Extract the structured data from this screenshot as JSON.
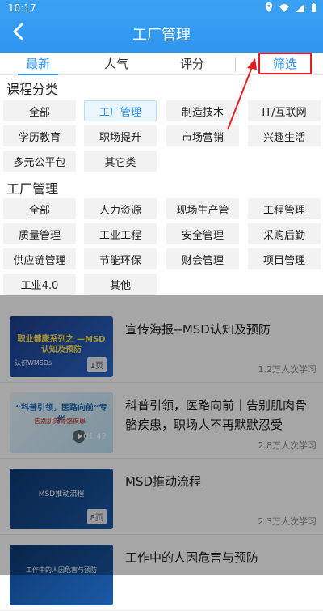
{
  "status": {
    "time": "10:17"
  },
  "header": {
    "title": "工厂管理"
  },
  "tabs": [
    {
      "label": "最新",
      "active": true
    },
    {
      "label": "人气",
      "active": false
    },
    {
      "label": "评分",
      "active": false
    },
    {
      "label": "筛选",
      "active": false
    }
  ],
  "sections": [
    {
      "title": "课程分类",
      "chips": [
        "全部",
        "工厂管理",
        "制造技术",
        "IT/互联网",
        "学历教育",
        "职场提升",
        "市场营销",
        "兴趣生活",
        "多元公平包",
        "其它类"
      ],
      "selected": "工厂管理"
    },
    {
      "title": "工厂管理",
      "chips": [
        "全部",
        "人力资源",
        "现场生产管",
        "工程管理",
        "质量管理",
        "工业工程",
        "安全管理",
        "采购后勤",
        "供应链管理",
        "节能环保",
        "财会管理",
        "项目管理",
        "工业4.0",
        "其他"
      ]
    }
  ],
  "list": [
    {
      "title": "宣传海报--MSD认知及预防",
      "meta": "1.2万人次学习",
      "badge": "1页",
      "thumb_text": "职业健康系列之 —MSD认知及预防",
      "thumb_sub": "认识WMSDs"
    },
    {
      "title": "科普引领，医路向前｜告别肌肉骨骼疾患，职场人不再默默忍受",
      "meta": "2.8万人次学习",
      "badge": "01:42",
      "thumb_text": "“科普引领，医路向前”专栏",
      "thumb_sub": "告别肌肉骨骼疾患"
    },
    {
      "title": "MSD推动流程",
      "meta": "2.3万人次学习",
      "badge": "8页",
      "thumb_text": "MSD推动流程",
      "thumb_sub": ""
    },
    {
      "title": "工作中的人因危害与预防",
      "meta": "",
      "badge": "",
      "thumb_text": "工作中的人因危害与预防",
      "thumb_sub": ""
    }
  ]
}
